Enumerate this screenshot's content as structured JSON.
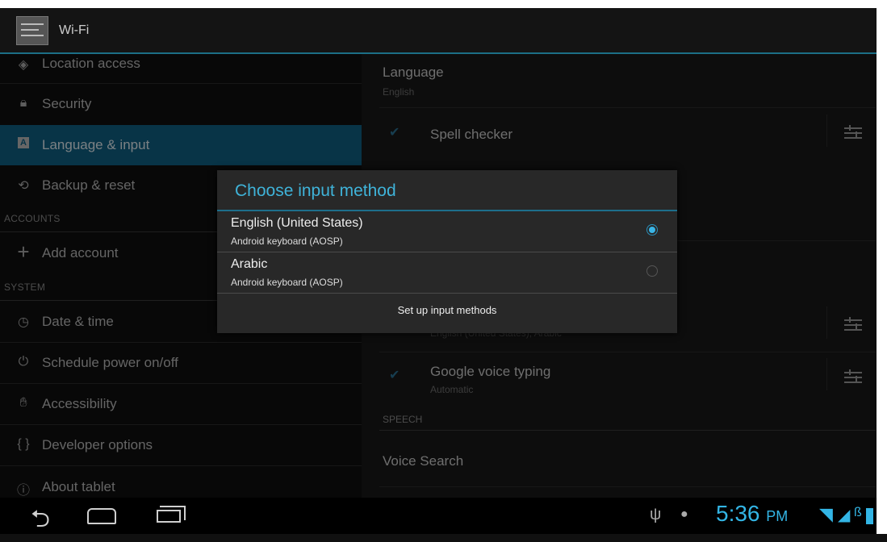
{
  "app_title": "Wi-Fi",
  "sidebar": {
    "items": [
      {
        "icon": "location-icon",
        "glyph": "◈",
        "label": "Location access"
      },
      {
        "icon": "lock-icon",
        "glyph": "🔒︎",
        "label": "Security"
      },
      {
        "icon": "language-icon",
        "glyph": "A",
        "label": "Language & input"
      },
      {
        "icon": "backup-icon",
        "glyph": "⟲",
        "label": "Backup & reset"
      },
      {
        "icon": "plus-icon",
        "glyph": "+",
        "label": "Add account"
      },
      {
        "icon": "clock-icon",
        "glyph": "◷",
        "label": "Date & time"
      },
      {
        "icon": "power-schedule-icon",
        "glyph": "⏻",
        "label": "Schedule power on/off"
      },
      {
        "icon": "hand-icon",
        "glyph": "✋︎",
        "label": "Accessibility"
      },
      {
        "icon": "braces-icon",
        "glyph": "{ }",
        "label": "Developer options"
      },
      {
        "icon": "info-icon",
        "glyph": "ⓘ",
        "label": "About tablet"
      }
    ],
    "headers": {
      "accounts": "ACCOUNTS",
      "system": "SYSTEM"
    }
  },
  "content": {
    "language_title": "Language",
    "language_value": "English",
    "spell_checker": "Spell checker",
    "partial_subtitle": "English (United States), Arabic",
    "voice_typing_title": "Google voice typing",
    "voice_typing_sub": "Automatic",
    "speech_header": "SPEECH",
    "voice_search": "Voice Search"
  },
  "dialog": {
    "title": "Choose input method",
    "options": [
      {
        "title": "English (United States)",
        "subtitle": "Android keyboard (AOSP)",
        "selected": true
      },
      {
        "title": "Arabic",
        "subtitle": "Android keyboard (AOSP)",
        "selected": false
      }
    ],
    "setup_label": "Set up input methods"
  },
  "status": {
    "time": "5:36",
    "ampm": "PM"
  },
  "colors": {
    "accent": "#33b5e5",
    "selected_bg": "#0f5f82"
  }
}
